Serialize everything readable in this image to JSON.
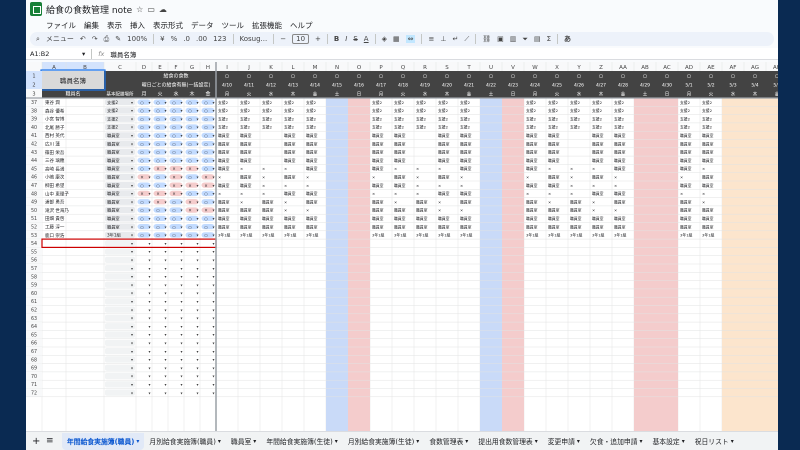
{
  "app": {
    "title": "給食の食数管理 note",
    "menu": [
      "ファイル",
      "編集",
      "表示",
      "挿入",
      "表示形式",
      "データ",
      "ツール",
      "拡張機能",
      "ヘルプ"
    ]
  },
  "toolbar": {
    "search": "メニュー",
    "zoom": "100%",
    "currency": "¥",
    "percent": "%",
    "dec_less": ".0",
    "dec_more": ".00",
    "number_fmt": "123",
    "font": "Kosug...",
    "font_size": "10",
    "bold": "B",
    "italic": "I",
    "strike": "S",
    "text_color": "A",
    "sigma": "Σ",
    "input_tools": "あ"
  },
  "formula": {
    "cell": "A1:B2",
    "fx": "fx",
    "content": "職員名簿"
  },
  "grid": {
    "cols": [
      "A",
      "B",
      "C",
      "D",
      "E",
      "F",
      "G",
      "H",
      "I",
      "J",
      "K",
      "L",
      "M",
      "N",
      "O",
      "P",
      "Q",
      "R",
      "S",
      "T",
      "U",
      "V",
      "W",
      "X",
      "Y",
      "Z",
      "AA",
      "AB",
      "AC",
      "AD",
      "AE",
      "AF",
      "AG",
      "AH",
      "AI",
      "AJ"
    ],
    "frozen_rows": [
      "1",
      "2",
      "3"
    ],
    "header": {
      "roster": "職員名簿",
      "meal_count": "給食の食数",
      "weekday_meals": "曜日ごとの給食有無(一括設定)",
      "name_col": "職員名",
      "place_col": "基本配膳場所"
    },
    "weekdays": [
      "月",
      "火",
      "水",
      "木",
      "金"
    ],
    "dates": [
      "4/10",
      "4/11",
      "4/12",
      "4/13",
      "4/14",
      "4/15",
      "4/16",
      "4/17",
      "4/18",
      "4/19",
      "4/20",
      "4/21",
      "4/22",
      "4/23",
      "4/24",
      "4/25",
      "4/26",
      "4/27",
      "4/28",
      "4/29",
      "4/30",
      "5/1",
      "5/2",
      "5/3",
      "5/4",
      "5/5",
      "5/6",
      "5/7"
    ],
    "date_days": [
      "月",
      "火",
      "水",
      "木",
      "金",
      "土",
      "日",
      "月",
      "火",
      "水",
      "木",
      "金",
      "土",
      "日",
      "月",
      "火",
      "水",
      "木",
      "金",
      "土",
      "日",
      "月",
      "火",
      "水",
      "木",
      "金",
      "土",
      "日"
    ],
    "circle": "○",
    "rows": [
      {
        "n": "37",
        "name": "東谷 潤",
        "place": "支援2",
        "vals": [
          "支援2",
          "支援2",
          "支援2",
          "支援2",
          "支援2",
          "",
          "",
          "支援2",
          "支援2",
          "支援2",
          "支援2",
          "支援2",
          "",
          "",
          "支援2",
          "支援2",
          "支援2",
          "支援2",
          "支援2",
          "",
          "",
          "支援2",
          "支援2",
          "",
          "",
          "",
          "",
          ""
        ]
      },
      {
        "n": "38",
        "name": "森谷 優希",
        "place": "支援2",
        "vals": [
          "支援2",
          "支援2",
          "支援2",
          "支援2",
          "支援2",
          "",
          "",
          "支援2",
          "支援2",
          "支援2",
          "支援2",
          "支援2",
          "",
          "",
          "支援2",
          "支援2",
          "支援2",
          "支援2",
          "支援2",
          "",
          "",
          "支援2",
          "支援2",
          "",
          "",
          "",
          "",
          ""
        ]
      },
      {
        "n": "39",
        "name": "小宮 智博",
        "place": "支援2",
        "vals": [
          "支援2",
          "支援2",
          "支援2",
          "支援2",
          "支援2",
          "",
          "",
          "支援2",
          "支援2",
          "支援2",
          "支援2",
          "支援2",
          "",
          "",
          "支援2",
          "支援2",
          "支援2",
          "支援2",
          "支援2",
          "",
          "",
          "支援2",
          "支援2",
          "",
          "",
          "",
          "",
          ""
        ]
      },
      {
        "n": "40",
        "name": "北尾 勝子",
        "place": "支援2",
        "vals": [
          "支援2",
          "支援2",
          "支援2",
          "支援2",
          "支援2",
          "",
          "",
          "支援2",
          "支援2",
          "支援2",
          "支援2",
          "支援2",
          "",
          "",
          "支援2",
          "支援2",
          "支援2",
          "支援2",
          "支援2",
          "",
          "",
          "支援2",
          "支援2",
          "",
          "",
          "",
          "",
          ""
        ]
      },
      {
        "n": "41",
        "name": "西村 英代",
        "place": "職員室",
        "vals": [
          "職員室",
          "職員室",
          "",
          "職員室",
          "職員室",
          "",
          "",
          "職員室",
          "職員室",
          "",
          "職員室",
          "職員室",
          "",
          "",
          "職員室",
          "職員室",
          "",
          "職員室",
          "職員室",
          "",
          "",
          "職員室",
          "職員室",
          "",
          "",
          "",
          "",
          ""
        ]
      },
      {
        "n": "42",
        "name": "広川 蓮",
        "place": "職員室",
        "vals": [
          "職員室",
          "職員室",
          "",
          "職員室",
          "職員室",
          "",
          "",
          "職員室",
          "職員室",
          "",
          "職員室",
          "職員室",
          "",
          "",
          "職員室",
          "職員室",
          "",
          "職員室",
          "職員室",
          "",
          "",
          "職員室",
          "職員室",
          "",
          "",
          "",
          "",
          ""
        ]
      },
      {
        "n": "43",
        "name": "篠田 栄吾",
        "place": "職員室",
        "vals": [
          "職員室",
          "職員室",
          "",
          "職員室",
          "職員室",
          "",
          "",
          "職員室",
          "職員室",
          "",
          "職員室",
          "職員室",
          "",
          "",
          "職員室",
          "職員室",
          "",
          "職員室",
          "職員室",
          "",
          "",
          "職員室",
          "職員室",
          "",
          "",
          "",
          "",
          ""
        ]
      },
      {
        "n": "44",
        "name": "三谷 璃穂",
        "place": "職員室",
        "vals": [
          "職員室",
          "職員室",
          "",
          "職員室",
          "職員室",
          "",
          "",
          "職員室",
          "職員室",
          "",
          "職員室",
          "職員室",
          "",
          "",
          "職員室",
          "職員室",
          "",
          "職員室",
          "職員室",
          "",
          "",
          "職員室",
          "職員室",
          "",
          "",
          "",
          "",
          ""
        ]
      },
      {
        "n": "45",
        "name": "高崎 長満",
        "place": "職員室",
        "vals": [
          "職員室",
          "×",
          "×",
          "×",
          "職員室",
          "",
          "",
          "職員室",
          "×",
          "×",
          "×",
          "職員室",
          "",
          "",
          "職員室",
          "×",
          "×",
          "×",
          "職員室",
          "",
          "",
          "職員室",
          "×",
          "",
          "",
          "",
          "",
          ""
        ]
      },
      {
        "n": "46",
        "name": "小嶋 康次",
        "place": "職員室",
        "vals": [
          "×",
          "職員室",
          "×",
          "職員室",
          "×",
          "",
          "",
          "×",
          "職員室",
          "×",
          "職員室",
          "×",
          "",
          "",
          "×",
          "職員室",
          "×",
          "職員室",
          "×",
          "",
          "",
          "×",
          "職員室",
          "",
          "",
          "",
          "",
          ""
        ]
      },
      {
        "n": "47",
        "name": "柳田 希望",
        "place": "職員室",
        "vals": [
          "職員室",
          "職員室",
          "×",
          "×",
          "×",
          "",
          "",
          "職員室",
          "職員室",
          "×",
          "×",
          "×",
          "",
          "",
          "職員室",
          "職員室",
          "×",
          "×",
          "×",
          "",
          "",
          "職員室",
          "職員室",
          "",
          "",
          "",
          "",
          ""
        ]
      },
      {
        "n": "48",
        "name": "山中 恵理子",
        "place": "職員室",
        "vals": [
          "×",
          "×",
          "×",
          "職員室",
          "職員室",
          "",
          "",
          "×",
          "×",
          "×",
          "職員室",
          "職員室",
          "",
          "",
          "×",
          "×",
          "×",
          "職員室",
          "職員室",
          "",
          "",
          "×",
          "×",
          "",
          "",
          "",
          "",
          ""
        ]
      },
      {
        "n": "49",
        "name": "浦部 勇吾",
        "place": "職員室",
        "vals": [
          "職員室",
          "×",
          "職員室",
          "×",
          "職員室",
          "",
          "",
          "職員室",
          "×",
          "職員室",
          "×",
          "職員室",
          "",
          "",
          "職員室",
          "×",
          "職員室",
          "×",
          "職員室",
          "",
          "",
          "職員室",
          "×",
          "",
          "",
          "",
          "",
          ""
        ]
      },
      {
        "n": "50",
        "name": "滝沢 世海乃",
        "place": "職員室",
        "vals": [
          "職員室",
          "職員室",
          "職員室",
          "×",
          "×",
          "",
          "",
          "職員室",
          "職員室",
          "職員室",
          "×",
          "×",
          "",
          "",
          "職員室",
          "職員室",
          "職員室",
          "×",
          "×",
          "",
          "",
          "職員室",
          "職員室",
          "",
          "",
          "",
          "",
          ""
        ]
      },
      {
        "n": "51",
        "name": "田畑 貴啓",
        "place": "職員室",
        "vals": [
          "職員室",
          "職員室",
          "職員室",
          "職員室",
          "職員室",
          "",
          "",
          "職員室",
          "職員室",
          "職員室",
          "職員室",
          "職員室",
          "",
          "",
          "職員室",
          "職員室",
          "職員室",
          "職員室",
          "職員室",
          "",
          "",
          "職員室",
          "職員室",
          "",
          "",
          "",
          "",
          ""
        ]
      },
      {
        "n": "52",
        "name": "工藤 淳一",
        "place": "職員室",
        "vals": [
          "職員室",
          "職員室",
          "職員室",
          "職員室",
          "職員室",
          "",
          "",
          "職員室",
          "職員室",
          "職員室",
          "職員室",
          "職員室",
          "",
          "",
          "職員室",
          "職員室",
          "職員室",
          "職員室",
          "職員室",
          "",
          "",
          "職員室",
          "職員室",
          "",
          "",
          "",
          "",
          ""
        ]
      },
      {
        "n": "53",
        "name": "鹿口 崇浩",
        "place": "3年1組",
        "vals": [
          "3年1組",
          "3年1組",
          "3年1組",
          "3年1組",
          "3年1組",
          "",
          "",
          "3年1組",
          "3年1組",
          "3年1組",
          "3年1組",
          "3年1組",
          "",
          "",
          "3年1組",
          "3年1組",
          "3年1組",
          "3年1組",
          "3年1組",
          "",
          "",
          "3年1組",
          "3年1組",
          "",
          "",
          "",
          "",
          ""
        ]
      }
    ],
    "empty_rows": [
      "54",
      "55",
      "56",
      "57",
      "58",
      "59",
      "60",
      "61",
      "62",
      "63",
      "64",
      "65",
      "66",
      "67",
      "68",
      "69",
      "70",
      "71",
      "72"
    ]
  },
  "tabs": {
    "add": "+",
    "all": "≡",
    "sheets": [
      "年間給食実施簿(職員)",
      "月別給食実施簿(職員)",
      "職員室",
      "年間給食実施簿(生徒)",
      "月別給食実施簿(生徒)",
      "食数管理表",
      "提出用食数管理表",
      "変更申請",
      "欠食・追加申請",
      "基本設定",
      "祝日リスト"
    ],
    "active": 0
  },
  "colors": {
    "header_dark": "#434343",
    "holiday_blue": "#c9daf8",
    "holiday_red": "#f4cccc",
    "gw_orange": "#fce5cd",
    "selected": "#cc0000",
    "active_tab": "#0b57d0"
  }
}
